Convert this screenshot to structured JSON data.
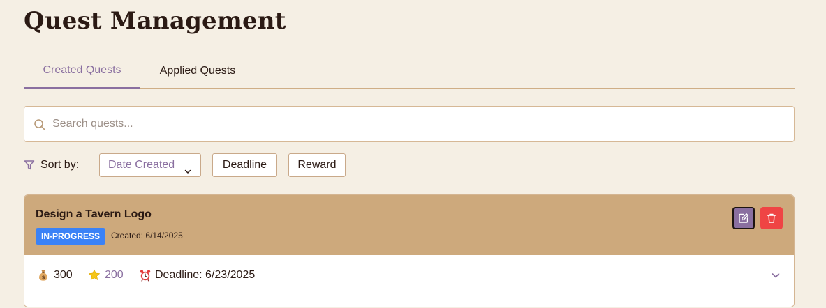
{
  "page": {
    "title": "Quest Management"
  },
  "tabs": [
    {
      "label": "Created Quests",
      "active": true
    },
    {
      "label": "Applied Quests",
      "active": false
    }
  ],
  "search": {
    "placeholder": "Search quests...",
    "value": "",
    "icon": "search-icon"
  },
  "sort": {
    "label": "Sort by:",
    "icon": "filter-icon",
    "options": [
      {
        "label": "Date Created",
        "active": true,
        "icon": "chevron-down-icon"
      },
      {
        "label": "Deadline",
        "active": false
      },
      {
        "label": "Reward",
        "active": false
      }
    ]
  },
  "quests": [
    {
      "title": "Design a Tavern Logo",
      "status": "IN-PROGRESS",
      "created": "Created: 6/14/2025",
      "gold": "300",
      "xp": "200",
      "deadline": "Deadline: 6/23/2025",
      "actions": [
        "edit-icon",
        "trash-icon"
      ]
    }
  ],
  "colors": {
    "background": "#f5efe4",
    "accent": "#8a6fa0",
    "card_header": "#cda97c",
    "status_in_progress": "#3b82f6",
    "danger": "#ef4444"
  }
}
